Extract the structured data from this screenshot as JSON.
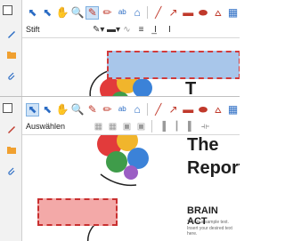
{
  "top_window": {
    "mode_label": "Stift"
  },
  "bottom_window": {
    "mode_label": "Auswählen"
  },
  "document": {
    "title_line1": "The",
    "title_line2": "Report",
    "heading": "BRAIN ACT",
    "body_line1": "This is a sample text.",
    "body_line2": "Insert your desired text here."
  },
  "colors": {
    "accent_blue": "#2b6cc4",
    "selection_red": "#d23a3a",
    "blue_fill": "#a8c6ea",
    "pink_fill": "#f3a9a8"
  },
  "icons": {
    "tools_row": [
      "select-arrow-icon",
      "text-select-icon",
      "hand-icon",
      "zoom-icon",
      "pen-icon",
      "highlighter-icon",
      "textbox-icon",
      "stamp-icon",
      "line-icon",
      "arrow-icon",
      "rectangle-icon",
      "ellipse-icon",
      "polygon-icon",
      "calendar-icon"
    ],
    "sidebar": [
      "pen-icon",
      "folder-icon",
      "attachment-icon"
    ]
  }
}
